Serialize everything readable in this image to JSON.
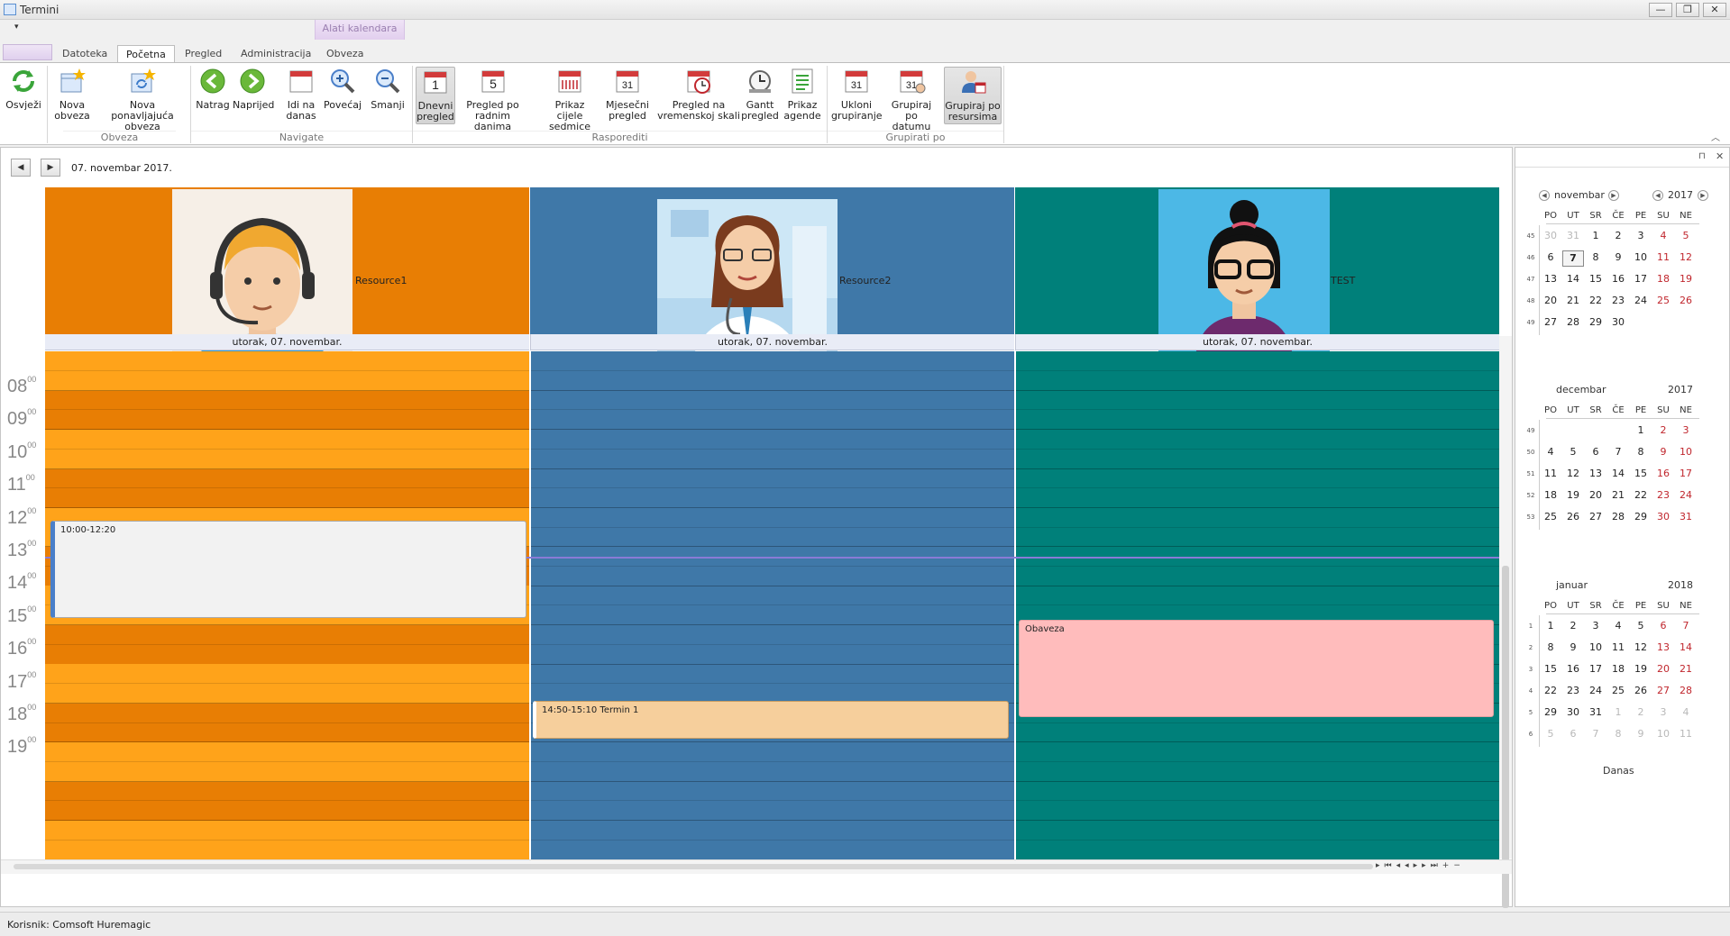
{
  "window": {
    "title": "Termini",
    "min": "—",
    "restore": "❐",
    "close": "✕"
  },
  "contextual_tab": "Alati kalendara",
  "qat_symbol": "▾",
  "tabs": [
    {
      "label": "Datoteka"
    },
    {
      "label": "Početna",
      "active": true
    },
    {
      "label": "Pregled"
    },
    {
      "label": "Administracija"
    },
    {
      "label": "Obveza"
    }
  ],
  "ribbon": {
    "buttons": [
      {
        "id": "refresh",
        "label": "Osvježi",
        "icon": "refresh-icon"
      },
      {
        "id": "new",
        "label": "Nova\nobveza",
        "icon": "new-appointment-icon"
      },
      {
        "id": "newrec",
        "label": "Nova ponavljajuća\nobveza",
        "icon": "new-recurring-appointment-icon"
      },
      {
        "id": "back",
        "label": "Natrag",
        "icon": "back-arrow-icon"
      },
      {
        "id": "fwd",
        "label": "Naprijed",
        "icon": "forward-arrow-icon"
      },
      {
        "id": "today",
        "label": "Idi na\ndanas",
        "icon": "calendar-today-icon"
      },
      {
        "id": "zoomin",
        "label": "Povećaj",
        "icon": "zoom-in-icon"
      },
      {
        "id": "zoomout",
        "label": "Smanji",
        "icon": "zoom-out-icon"
      },
      {
        "id": "day",
        "label": "Dnevni\npregled",
        "icon": "day-view-icon",
        "selected": true,
        "num": "1"
      },
      {
        "id": "workweek",
        "label": "Pregled po\nradnim danima",
        "icon": "work-week-view-icon",
        "num": "5"
      },
      {
        "id": "week",
        "label": "Prikaz\ncijele sedmice",
        "icon": "week-view-icon"
      },
      {
        "id": "month",
        "label": "Mjesečni\npregled",
        "icon": "month-view-icon",
        "num": "31"
      },
      {
        "id": "timeline",
        "label": "Pregled na\nvremenskoj skali",
        "icon": "timeline-view-icon"
      },
      {
        "id": "gantt",
        "label": "Gantt\npregled",
        "icon": "gantt-view-icon"
      },
      {
        "id": "agenda",
        "label": "Prikaz\nagende",
        "icon": "agenda-view-icon"
      },
      {
        "id": "ungroup",
        "label": "Ukloni\ngrupiranje",
        "icon": "ungroup-icon",
        "num": "31"
      },
      {
        "id": "groupdate",
        "label": "Grupiraj\npo datumu",
        "icon": "group-by-date-icon",
        "num": "31"
      },
      {
        "id": "groupres",
        "label": "Grupiraj po\nresursima",
        "icon": "group-by-resource-icon",
        "selected": true
      }
    ],
    "groups": [
      "Obveza",
      "Navigate",
      "Rasporediti",
      "Grupirati po"
    ]
  },
  "nav": {
    "date_caption": "07. novembar 2017.",
    "prev": "◀",
    "next": "▶"
  },
  "resources": [
    {
      "name": "Resource1",
      "color": "#e87e04",
      "day": "utorak, 07. novembar."
    },
    {
      "name": "Resource2",
      "color": "#3f78a8",
      "day": "utorak, 07. novembar."
    },
    {
      "name": "TEST",
      "color": "#00807a",
      "day": "utorak, 07. novembar."
    }
  ],
  "hours": [
    "08",
    "09",
    "10",
    "11",
    "12",
    "13",
    "14",
    "15",
    "16",
    "17",
    "18",
    "19"
  ],
  "hours_sup": "00",
  "appointments": [
    {
      "text": "10:00-12:20",
      "resource": 0
    },
    {
      "text": "14:50-15:10 Termin 1",
      "resource": 1
    },
    {
      "text": "Obaveza",
      "resource": 2
    }
  ],
  "calendar": {
    "dow": [
      "PO",
      "UT",
      "SR",
      "ČE",
      "PE",
      "SU",
      "NE"
    ],
    "months": [
      {
        "month": "novembar",
        "year": "2017",
        "weeks": [
          "45",
          "46",
          "47",
          "48",
          "49"
        ],
        "rows": [
          [
            "30",
            "31",
            "1",
            "2",
            "3",
            "4",
            "5"
          ],
          [
            "6",
            "7",
            "8",
            "9",
            "10",
            "11",
            "12"
          ],
          [
            "13",
            "14",
            "15",
            "16",
            "17",
            "18",
            "19"
          ],
          [
            "20",
            "21",
            "22",
            "23",
            "24",
            "25",
            "26"
          ],
          [
            "27",
            "28",
            "29",
            "30",
            "",
            "",
            ""
          ]
        ]
      },
      {
        "month": "decembar",
        "year": "2017",
        "weeks": [
          "49",
          "50",
          "51",
          "52",
          "53"
        ],
        "rows": [
          [
            "",
            "",
            "",
            "",
            "1",
            "2",
            "3"
          ],
          [
            "4",
            "5",
            "6",
            "7",
            "8",
            "9",
            "10"
          ],
          [
            "11",
            "12",
            "13",
            "14",
            "15",
            "16",
            "17"
          ],
          [
            "18",
            "19",
            "20",
            "21",
            "22",
            "23",
            "24"
          ],
          [
            "25",
            "26",
            "27",
            "28",
            "29",
            "30",
            "31"
          ]
        ]
      },
      {
        "month": "januar",
        "year": "2018",
        "weeks": [
          "1",
          "2",
          "3",
          "4",
          "5",
          "6"
        ],
        "rows": [
          [
            "1",
            "2",
            "3",
            "4",
            "5",
            "6",
            "7"
          ],
          [
            "8",
            "9",
            "10",
            "11",
            "12",
            "13",
            "14"
          ],
          [
            "15",
            "16",
            "17",
            "18",
            "19",
            "20",
            "21"
          ],
          [
            "22",
            "23",
            "24",
            "25",
            "26",
            "27",
            "28"
          ],
          [
            "29",
            "30",
            "31",
            "1",
            "2",
            "3",
            "4"
          ],
          [
            "5",
            "6",
            "7",
            "8",
            "9",
            "10",
            "11"
          ]
        ]
      }
    ],
    "today_label": "Danas"
  },
  "status": {
    "user": "Korisnik: Comsoft Huremagic"
  }
}
